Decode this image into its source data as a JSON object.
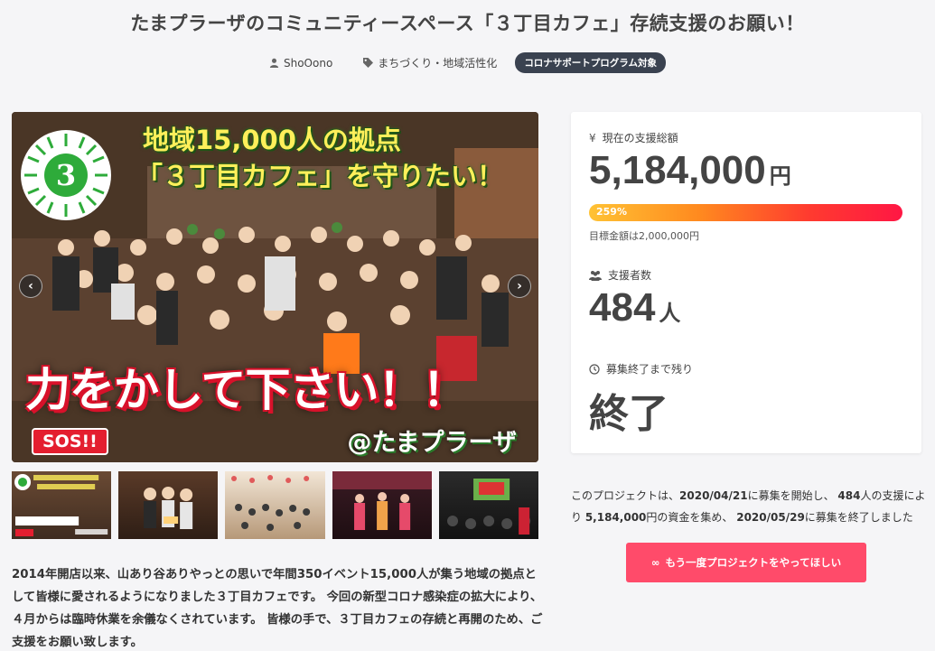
{
  "project": {
    "title": "たまプラーザのコミュニティースペース「３丁目カフェ」存続支援のお願い！",
    "owner": "ShoOono",
    "category": "まちづくり・地域活性化",
    "badge": "コロナサポートプログラム対象"
  },
  "hero": {
    "line1": "地域15,000人の拠点",
    "line2": "「３丁目カフェ」を守りたい！",
    "logo_number": "3",
    "main_text": "力をかして下さい！！",
    "sos": "SOS!!",
    "tag": "@たまプラーザ"
  },
  "thumbnails": [
    {
      "name": "thumb-cover"
    },
    {
      "name": "thumb-party"
    },
    {
      "name": "thumb-event-hall"
    },
    {
      "name": "thumb-stage"
    },
    {
      "name": "thumb-screening"
    }
  ],
  "description": "2014年開店以来、山あり谷ありやっとの思いで年間350イベント15,000人が集う地域の拠点として皆様に愛されるようになりました３丁目カフェです。 今回の新型コロナ感染症の拡大により、４月からは臨時休業を余儀なくされています。 皆様の手で、３丁目カフェの存続と再開のため、ご支援をお願い致します。",
  "stats": {
    "total_label": "現在の支援総額",
    "total_value": "5,184,000",
    "total_unit": "円",
    "progress_percent": "259%",
    "progress_fraction": 1.0,
    "goal": "目標金額は2,000,000円",
    "supporters_label": "支援者数",
    "supporters_value": "484",
    "supporters_unit": "人",
    "remaining_label": "募集終了まで残り",
    "remaining_value": "終了"
  },
  "summary": {
    "p1": "このプロジェクトは、",
    "start": "2020/04/21",
    "p2": "に募集を開始し、 ",
    "count": "484",
    "p3": "人の支援により ",
    "amount": "5,184,000",
    "p4": "円の資金を集め、 ",
    "end": "2020/05/29",
    "p5": "に募集を終了しました"
  },
  "cta": {
    "icon": "∞",
    "label": "もう一度プロジェクトをやってほしい"
  },
  "colors": {
    "accent": "#ff4b6a",
    "badge": "#3a4250",
    "progress_start": "#ffc234",
    "progress_end": "#ff1744"
  }
}
